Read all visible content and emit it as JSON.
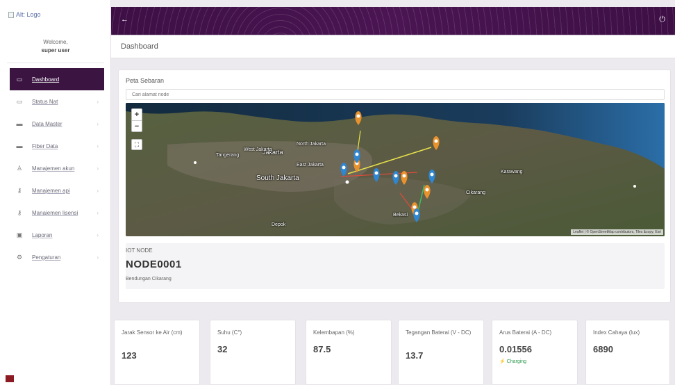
{
  "sidebar": {
    "logo_alt": "Alt: Logo",
    "welcome": "Welcome,",
    "username": "super user",
    "items": [
      {
        "label": "Dashboard",
        "icon": "monitor-icon"
      },
      {
        "label": "Status Nat",
        "icon": "monitor-icon"
      },
      {
        "label": "Data Master",
        "icon": "folder-icon"
      },
      {
        "label": "Fiber Data",
        "icon": "folder-icon"
      },
      {
        "label": "Manajemen akun",
        "icon": "users-icon"
      },
      {
        "label": "Manajemen api",
        "icon": "key-icon"
      },
      {
        "label": "Manajemen lisensi",
        "icon": "key-icon"
      },
      {
        "label": "Laporan",
        "icon": "book-icon"
      },
      {
        "label": "Pengaturan",
        "icon": "gear-icon"
      }
    ]
  },
  "topbar": {
    "back_icon": "arrow-left-icon",
    "power_icon": "power-icon"
  },
  "page": {
    "title": "Dashboard"
  },
  "map_card": {
    "title": "Peta Sebaran",
    "search_placeholder": "Cari alamat node",
    "zoom_in": "+",
    "zoom_out": "−",
    "fullscreen_glyph": "⛶",
    "attribution": "Leaflet | © OpenStreetMap contributors, Tiles &copy; Esri",
    "labels": {
      "jakarta": "Jakarta",
      "north_jakarta": "North Jakarta",
      "south_jakarta": "South Jakarta",
      "east_jakarta": "East Jakarta",
      "west_jakarta": "West Jakarta",
      "tangerang": "Tangerang",
      "bekasi": "Bekasi",
      "depok": "Depok",
      "karawang": "Karawang",
      "cikarang": "Cikarang"
    }
  },
  "node": {
    "kicker": "IOT NODE",
    "name": "NODE0001",
    "location": "Bendungan Cikarang"
  },
  "stats": [
    {
      "label": "Jarak Sensor ke Air (cm)",
      "value": "123"
    },
    {
      "label": "Suhu (C°)",
      "value": "32"
    },
    {
      "label": "Kelembapan (%)",
      "value": "87.5"
    },
    {
      "label": "Tegangan Baterai (V - DC)",
      "value": "13.7"
    },
    {
      "label": "Arus Baterai (A - DC)",
      "value": "0.01556",
      "status": "⚡ Charging"
    },
    {
      "label": "Index Cahaya (lux)",
      "value": "6890"
    }
  ],
  "colors": {
    "brand": "#3b1442",
    "charging": "#2e9a4e",
    "pin_orange": "#e8922e",
    "pin_blue": "#2f86d1"
  }
}
